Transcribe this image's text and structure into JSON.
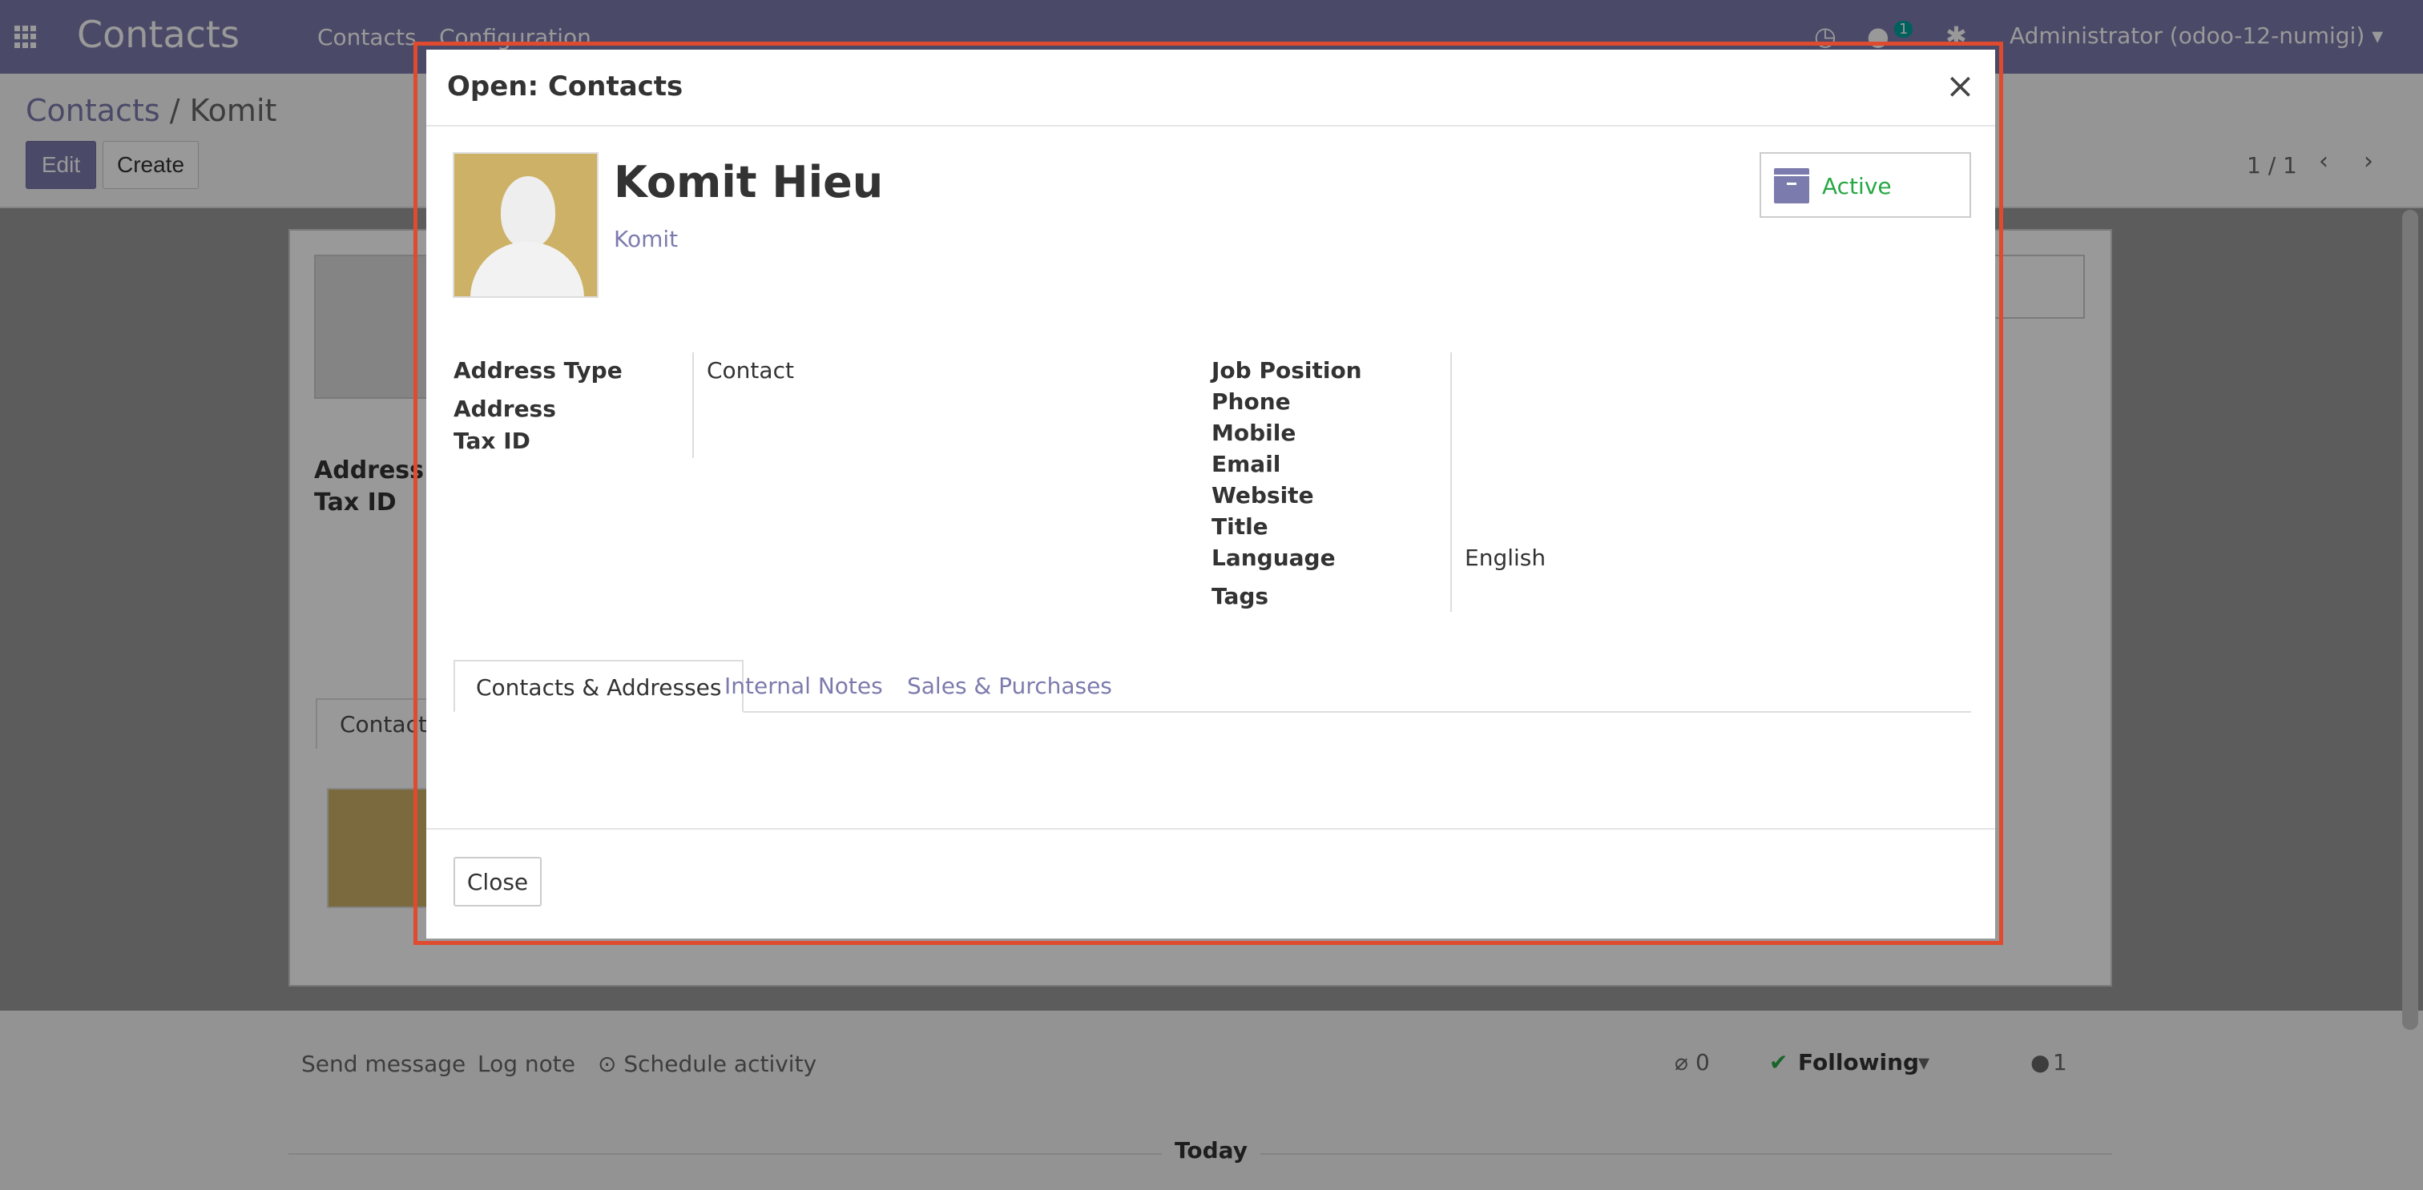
{
  "app": {
    "brand": "Contacts",
    "menu": [
      "Contacts",
      "Configuration"
    ],
    "notification_count": "1",
    "user": "Administrator (odoo-12-numigi) ▾"
  },
  "control_panel": {
    "breadcrumb_root": "Contacts",
    "breadcrumb_separator": "/",
    "breadcrumb_current": "Komit",
    "edit_label": "Edit",
    "create_label": "Create",
    "pager": "1 / 1"
  },
  "background_form": {
    "address_label": "Address",
    "tax_id_label": "Tax ID",
    "tab_contacts": "Contacts"
  },
  "chatter": {
    "send_message": "Send message",
    "log_note": "Log note",
    "schedule_activity": "⊙ Schedule activity",
    "attachments": "0",
    "following": "Following",
    "followers": "1",
    "today": "Today"
  },
  "modal": {
    "title": "Open: Contacts",
    "contact_name": "Komit Hieu",
    "company": "Komit",
    "active_label": "Active",
    "left_fields": [
      {
        "label": "Address Type",
        "value": "Contact"
      },
      {
        "label": "Address",
        "value": ""
      },
      {
        "label": "Tax ID",
        "value": ""
      }
    ],
    "right_fields": [
      {
        "label": "Job Position",
        "value": ""
      },
      {
        "label": "Phone",
        "value": ""
      },
      {
        "label": "Mobile",
        "value": ""
      },
      {
        "label": "Email",
        "value": ""
      },
      {
        "label": "Website",
        "value": ""
      },
      {
        "label": "Title",
        "value": ""
      },
      {
        "label": "Language",
        "value": "English"
      },
      {
        "label": "Tags",
        "value": ""
      }
    ],
    "tabs": [
      "Contacts & Addresses",
      "Internal Notes",
      "Sales & Purchases"
    ],
    "close_label": "Close"
  },
  "colors": {
    "brand": "#7c7bad",
    "active": "#28a745",
    "highlight": "#e04a2f"
  }
}
